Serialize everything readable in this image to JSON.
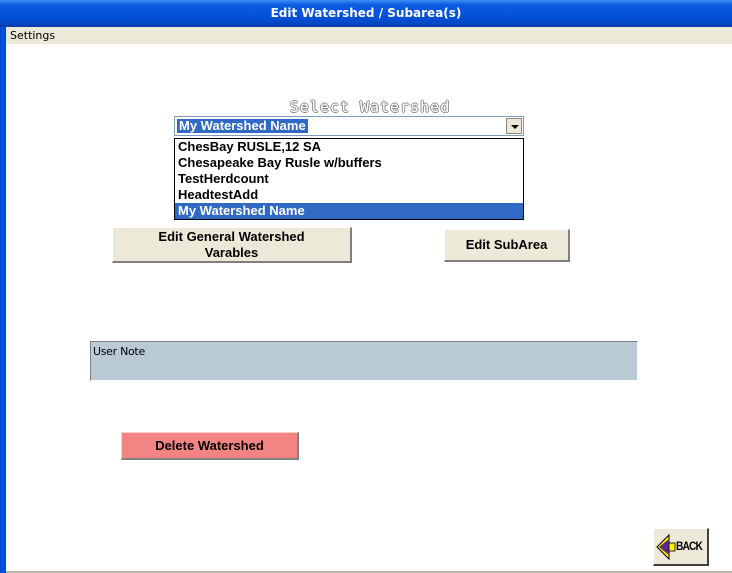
{
  "window": {
    "title": "Edit Watershed /  Subarea(s)"
  },
  "menu": {
    "items": [
      "Settings"
    ]
  },
  "select_watershed": {
    "label": "Select Watershed",
    "selected": "My Watershed Name",
    "options": [
      "ChesBay RUSLE,12 SA",
      "Chesapeake Bay Rusle w/buffers",
      "TestHerdcount",
      "HeadtestAdd",
      "My Watershed Name"
    ],
    "selected_index": 4
  },
  "buttons": {
    "edit_general": "Edit General Watershed Varables",
    "edit_subarea": "Edit SubArea",
    "delete": "Delete Watershed",
    "back": "BACK"
  },
  "user_note": {
    "label": "User Note"
  },
  "colors": {
    "title_bar": "#0454dc",
    "selection": "#316ac5",
    "note_bg": "#b9cad4",
    "delete_bg": "#f48484",
    "button_face": "#ece9d8"
  },
  "icons": {
    "back": "back-arrow-icon",
    "dropdown": "chevron-down-icon"
  }
}
